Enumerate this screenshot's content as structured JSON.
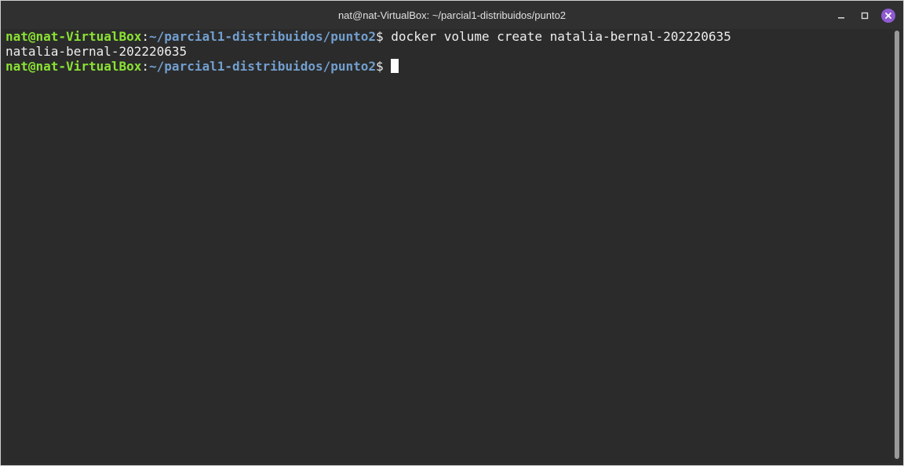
{
  "window": {
    "title": "nat@nat-VirtualBox: ~/parcial1-distribuidos/punto2",
    "controls": {
      "minimize_icon": "minimize-icon",
      "maximize_icon": "maximize-icon",
      "close_icon": "close-icon"
    }
  },
  "terminal": {
    "lines": [
      {
        "user_host": "nat@nat-VirtualBox",
        "separator": ":",
        "path": "~/parcial1-distribuidos/punto2",
        "prompt_symbol": "$",
        "command": " docker volume create natalia-bernal-202220635"
      },
      {
        "output": "natalia-bernal-202220635"
      },
      {
        "user_host": "nat@nat-VirtualBox",
        "separator": ":",
        "path": "~/parcial1-distribuidos/punto2",
        "prompt_symbol": "$",
        "command": " "
      }
    ]
  },
  "colors": {
    "user_host": "#8ae234",
    "path": "#729fcf",
    "background": "#2b2b2b",
    "close_button": "#8e5bd0"
  }
}
